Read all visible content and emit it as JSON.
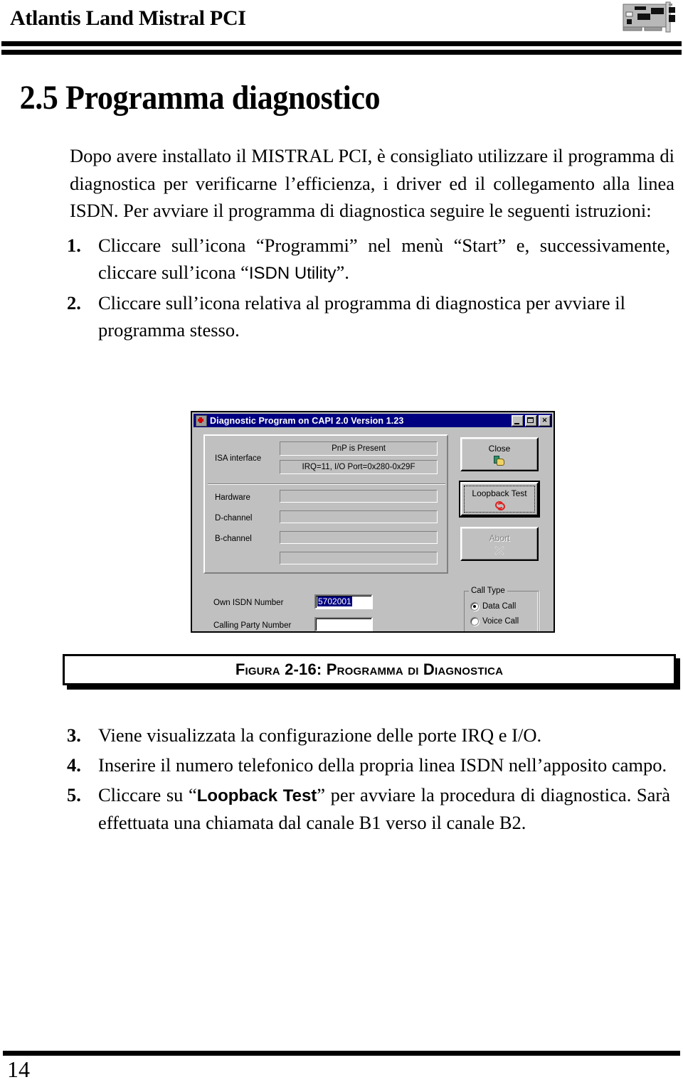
{
  "header": {
    "title": "Atlantis Land Mistral PCI",
    "card_icon": "pci-card-icon"
  },
  "section": {
    "title": "2.5 Programma diagnostico",
    "intro": "Dopo avere installato il MISTRAL PCI, è consigliato utilizzare il programma di diagnostica per verificarne l’efficienza, i driver ed il collegamento alla linea ISDN. Per avviare il programma di diagnostica seguire le seguenti istruzioni:"
  },
  "steps_before_figure": [
    {
      "num": "1.",
      "part1": "Cliccare sull’icona “Programmi” nel menù “Start” e, successivamente, cliccare sull’icona “",
      "emphasis": "ISDN Utility",
      "part2": "”."
    },
    {
      "num": "2.",
      "part1": "Cliccare sull’icona relativa al programma di diagnostica per avviare il programma stesso.",
      "emphasis": "",
      "part2": ""
    }
  ],
  "steps_after_figure": [
    {
      "num": "3.",
      "part1": "Viene visualizzata la configurazione delle porte IRQ e I/O.",
      "emphasis": "",
      "part2": ""
    },
    {
      "num": "4.",
      "part1": "Inserire il numero telefonico della propria linea ISDN nell’apposito campo.",
      "emphasis": "",
      "part2": ""
    },
    {
      "num": "5.",
      "part1": "Cliccare su “",
      "emphasis": "Loopback Test",
      "part2": "” per avviare la procedura di diagnostica. Sarà effettuata una chiamata dal canale B1 verso il canale B2."
    }
  ],
  "dialog": {
    "title": "Diagnostic Program on CAPI 2.0 Version 1.23",
    "title_icon": "first-aid-kit-icon",
    "titlebar_color": "#000080",
    "face_color": "#c0c0c0",
    "window_buttons": {
      "minimize": "_",
      "maximize": "□",
      "close": "✕"
    },
    "isa": {
      "label": "ISA interface",
      "status_pnp": "PnP is Present",
      "status_res": "IRQ=11, I/O Port=0x280-0x29F"
    },
    "status_rows": [
      {
        "label": "Hardware",
        "value": ""
      },
      {
        "label": "D-channel",
        "value": ""
      },
      {
        "label": "B-channel",
        "value": ""
      },
      {
        "label": "",
        "value": ""
      }
    ],
    "buttons": [
      {
        "label": "Close",
        "icon": "close-door-hand-icon",
        "state": "normal"
      },
      {
        "label": "Loopback Test",
        "icon": "loopback-arrows-icon",
        "state": "focused"
      },
      {
        "label": "Abort",
        "icon": "abort-cross-icon",
        "state": "disabled"
      }
    ],
    "fields": [
      {
        "label": "Own ISDN Number",
        "value": "5702001",
        "selected": true,
        "placeholder": ""
      },
      {
        "label": "Calling Party Number",
        "value": "",
        "selected": false,
        "placeholder": ""
      }
    ],
    "call_type": {
      "title": "Call Type",
      "options": [
        {
          "label": "Data Call",
          "checked": true
        },
        {
          "label": "Voice Call",
          "checked": false
        }
      ]
    }
  },
  "figure": {
    "caption": "Figura 2-16: Programma di Diagnostica"
  },
  "footer": {
    "page_number": "14"
  }
}
